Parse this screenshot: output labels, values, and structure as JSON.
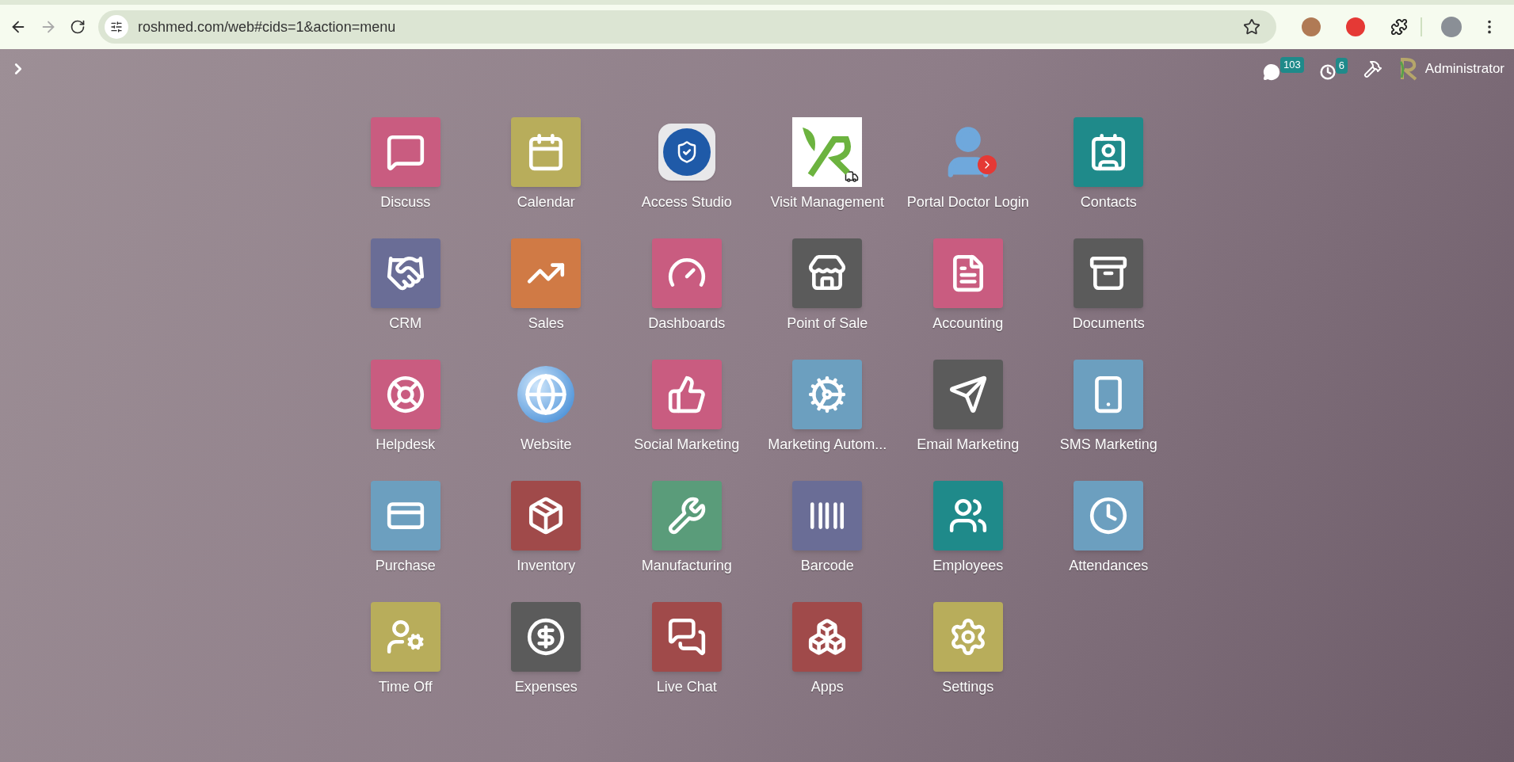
{
  "browser": {
    "url": "roshmed.com/web#cids=1&action=menu",
    "forward_disabled": true
  },
  "navbar": {
    "messages_count": "103",
    "activities_count": "6",
    "user": "Administrator"
  },
  "apps": [
    {
      "label": "Discuss",
      "kind": "chat",
      "color": "#c95c80"
    },
    {
      "label": "Calendar",
      "kind": "calendar",
      "color": "#b8ad5b"
    },
    {
      "label": "Access Studio",
      "kind": "studio"
    },
    {
      "label": "Visit Management",
      "kind": "visit"
    },
    {
      "label": "Portal Doctor Login",
      "kind": "portal"
    },
    {
      "label": "Contacts",
      "kind": "contact",
      "color": "#1f8a8a"
    },
    {
      "label": "CRM",
      "kind": "handshake",
      "color": "#6a6d96"
    },
    {
      "label": "Sales",
      "kind": "trend",
      "color": "#d07a45"
    },
    {
      "label": "Dashboards",
      "kind": "gauge",
      "color": "#c95c80"
    },
    {
      "label": "Point of Sale",
      "kind": "store",
      "color": "#5b5b5b"
    },
    {
      "label": "Accounting",
      "kind": "file",
      "color": "#c95c80"
    },
    {
      "label": "Documents",
      "kind": "archive",
      "color": "#5b5b5b"
    },
    {
      "label": "Helpdesk",
      "kind": "lifebuoy",
      "color": "#c95c80"
    },
    {
      "label": "Website",
      "kind": "globe"
    },
    {
      "label": "Social Marketing",
      "kind": "thumb",
      "color": "#c95c80"
    },
    {
      "label": "Marketing Autom...",
      "kind": "cog",
      "color": "#6c9fbf"
    },
    {
      "label": "Email Marketing",
      "kind": "send",
      "color": "#5b5b5b"
    },
    {
      "label": "SMS Marketing",
      "kind": "sms",
      "color": "#6c9fbf"
    },
    {
      "label": "Purchase",
      "kind": "card",
      "color": "#6c9fbf"
    },
    {
      "label": "Inventory",
      "kind": "package",
      "color": "#a04a4a"
    },
    {
      "label": "Manufacturing",
      "kind": "wrench",
      "color": "#5a9c7a"
    },
    {
      "label": "Barcode",
      "kind": "barcode",
      "color": "#6a6d96"
    },
    {
      "label": "Employees",
      "kind": "users",
      "color": "#1f8a8a"
    },
    {
      "label": "Attendances",
      "kind": "userclock",
      "color": "#6c9fbf"
    },
    {
      "label": "Time Off",
      "kind": "usercog",
      "color": "#b8ad5b"
    },
    {
      "label": "Expenses",
      "kind": "dollar",
      "color": "#5b5b5b"
    },
    {
      "label": "Live Chat",
      "kind": "messages",
      "color": "#a04a4a"
    },
    {
      "label": "Apps",
      "kind": "boxes",
      "color": "#a04a4a"
    },
    {
      "label": "Settings",
      "kind": "settings",
      "color": "#b8ad5b"
    }
  ]
}
